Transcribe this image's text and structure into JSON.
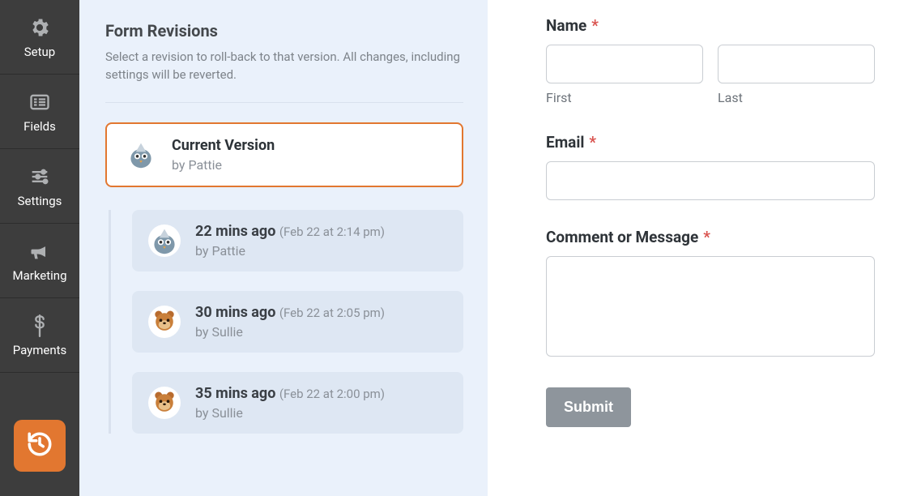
{
  "sidebar": {
    "items": [
      {
        "label": "Setup",
        "icon": "gear-icon"
      },
      {
        "label": "Fields",
        "icon": "list-icon"
      },
      {
        "label": "Settings",
        "icon": "sliders-icon"
      },
      {
        "label": "Marketing",
        "icon": "bullhorn-icon"
      },
      {
        "label": "Payments",
        "icon": "dollar-icon"
      }
    ],
    "history_button": "history-icon"
  },
  "revisions": {
    "title": "Form Revisions",
    "subtitle": "Select a revision to roll-back to that version. All changes, including settings will be reverted.",
    "current": {
      "title": "Current Version",
      "by": "by Pattie",
      "avatar": "pigeon"
    },
    "items": [
      {
        "time_ago": "22 mins ago",
        "timestamp": "(Feb 22 at 2:14 pm)",
        "by": "by Pattie",
        "avatar": "pigeon"
      },
      {
        "time_ago": "30 mins ago",
        "timestamp": "(Feb 22 at 2:05 pm)",
        "by": "by Sullie",
        "avatar": "bear"
      },
      {
        "time_ago": "35 mins ago",
        "timestamp": "(Feb 22 at 2:00 pm)",
        "by": "by Sullie",
        "avatar": "bear"
      }
    ]
  },
  "form": {
    "name_label": "Name",
    "first_sublabel": "First",
    "last_sublabel": "Last",
    "email_label": "Email",
    "comment_label": "Comment or Message",
    "submit_label": "Submit",
    "required_mark": "*"
  },
  "colors": {
    "accent": "#e27730",
    "panel": "#eaf1fb",
    "sidebar": "#3d3d3d"
  }
}
